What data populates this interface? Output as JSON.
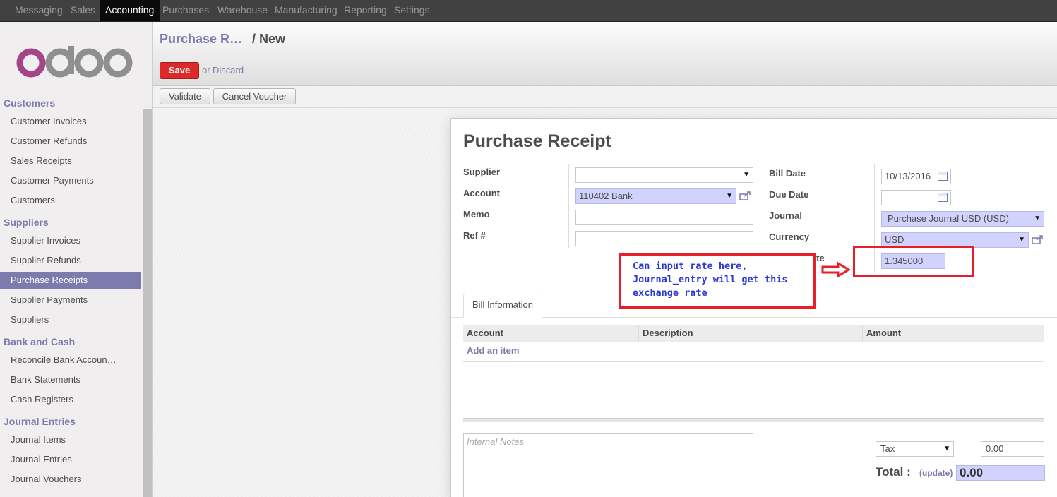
{
  "topmenu": {
    "items": [
      "Messaging",
      "Sales",
      "Accounting",
      "Purchases",
      "Warehouse",
      "Manufacturing",
      "Reporting",
      "Settings"
    ],
    "active": "Accounting"
  },
  "sidebar": {
    "logo_text": "odoo",
    "sections": [
      {
        "title": "Customers",
        "items": [
          "Customer Invoices",
          "Customer Refunds",
          "Sales Receipts",
          "Customer Payments",
          "Customers"
        ]
      },
      {
        "title": "Suppliers",
        "items": [
          "Supplier Invoices",
          "Supplier Refunds",
          "Purchase Receipts",
          "Supplier Payments",
          "Suppliers"
        ]
      },
      {
        "title": "Bank and Cash",
        "items": [
          "Reconcile Bank Accoun…",
          "Bank Statements",
          "Cash Registers"
        ]
      },
      {
        "title": "Journal Entries",
        "items": [
          "Journal Items",
          "Journal Entries",
          "Journal Vouchers"
        ]
      }
    ],
    "active_item": "Purchase Receipts"
  },
  "header": {
    "breadcrumb_parent": "Purchase R…",
    "breadcrumb_current": "/ New",
    "save_label": "Save",
    "or_text": "or",
    "discard_label": "Discard"
  },
  "statusbar": {
    "validate_label": "Validate",
    "cancel_label": "Cancel Voucher"
  },
  "form": {
    "title": "Purchase Receipt",
    "left_fields": [
      {
        "label": "Supplier",
        "value": ""
      },
      {
        "label": "Account",
        "value": "110402 Bank"
      },
      {
        "label": "Memo",
        "value": ""
      },
      {
        "label": "Ref #",
        "value": ""
      }
    ],
    "right_fields": [
      {
        "label": "Bill Date",
        "value": "10/13/2016"
      },
      {
        "label": "Due Date",
        "value": ""
      },
      {
        "label": "Journal",
        "value": "Purchase Journal USD (USD)"
      },
      {
        "label": "Currency",
        "value": "USD"
      },
      {
        "label": "Current Rate",
        "value": "1.345000"
      }
    ],
    "tab_label": "Bill Information",
    "grid_columns": [
      "Account",
      "Description",
      "Amount"
    ],
    "add_item_label": "Add an item",
    "notes_placeholder": "Internal Notes",
    "tax_select": "Tax",
    "tax_value": "0.00",
    "total_label": "Total :",
    "update_label": "(update)",
    "total_value": "0.00"
  },
  "annotation": {
    "lines": [
      "Can input rate here,",
      "Journal_entry will get this",
      "exchange rate"
    ],
    "color": "#e5202a",
    "text_color": "#2d39d6"
  },
  "colors": {
    "brand": "#7c7bad",
    "save": "#dc2a2a",
    "required_field": "#d2d2ff"
  },
  "icons": [
    "odoo-logo",
    "calendar-icon",
    "external-link-icon",
    "dropdown-caret-icon",
    "right-arrow-icon"
  ]
}
